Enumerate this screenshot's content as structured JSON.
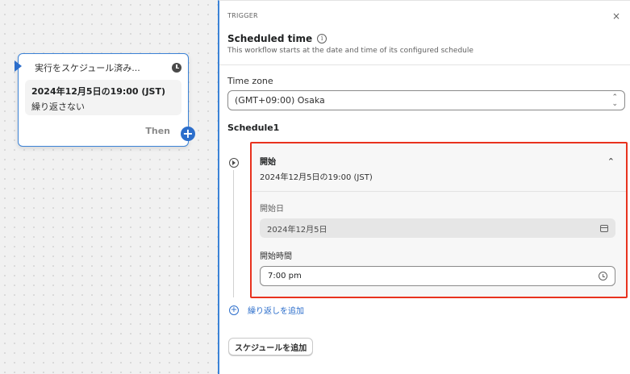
{
  "node": {
    "title": "実行をスケジュール済み...",
    "date": "2024年12月5日の19:00 (JST)",
    "repeat": "繰り返さない",
    "then": "Then",
    "add": "+"
  },
  "panel": {
    "kicker": "TRIGGER",
    "close": "×",
    "title": "Scheduled time",
    "info": "i",
    "description": "This workflow starts at the date and time of its configured schedule",
    "timezone_label": "Time zone",
    "timezone_value": "(GMT+09:00) Osaka",
    "schedule_label": "Schedule1",
    "start": {
      "title": "開始",
      "summary": "2024年12月5日の19:00 (JST)",
      "date_label": "開始日",
      "date_value": "2024年12月5日",
      "time_label": "開始時間",
      "time_value": "7:00 pm"
    },
    "add_repeat": "繰り返しを追加",
    "add_schedule": "スケジュールを追加"
  },
  "colors": {
    "accent": "#2c6ecb",
    "highlight": "#e8321e"
  }
}
